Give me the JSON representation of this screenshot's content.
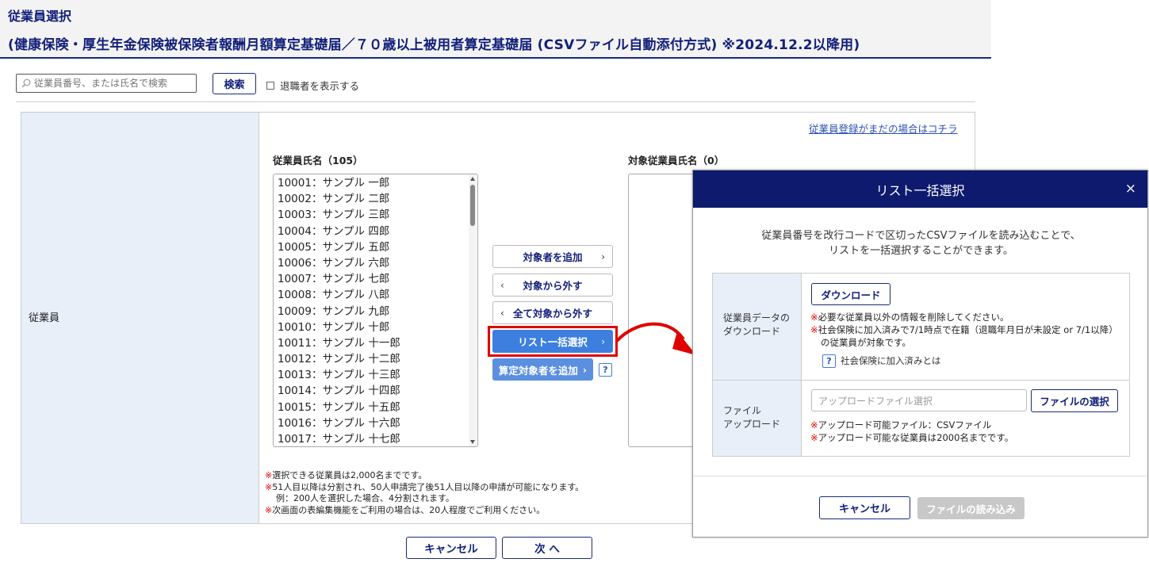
{
  "header": {
    "title": "従業員選択",
    "subtitle": "(健康保険・厚生年金保険被保険者報酬月額算定基礎届／７０歳以上被用者算定基礎届 (CSVファイル自動添付方式) ※2024.12.2以降用)"
  },
  "search": {
    "placeholder": "従業員番号、または氏名で検索",
    "button_label": "検索",
    "show_retired_label": "退職者を表示する"
  },
  "main": {
    "row_label": "従業員",
    "register_link": "従業員登録がまだの場合はコチラ",
    "employee_list_title": "従業員氏名（105）",
    "target_list_title": "対象従業員氏名（0）",
    "employees": [
      "10001：サンプル 一郎",
      "10002：サンプル 二郎",
      "10003：サンプル 三郎",
      "10004：サンプル 四郎",
      "10005：サンプル 五郎",
      "10006：サンプル 六郎",
      "10007：サンプル 七郎",
      "10008：サンプル 八郎",
      "10009：サンプル 九郎",
      "10010：サンプル 十郎",
      "10011：サンプル 十一郎",
      "10012：サンプル 十二郎",
      "10013：サンプル 十三郎",
      "10014：サンプル 十四郎",
      "10015：サンプル 十五郎",
      "10016：サンプル 十六郎",
      "10017：サンプル 十七郎"
    ],
    "buttons": {
      "add": "対象者を追加",
      "remove": "対象から外す",
      "remove_all": "全て対象から外す",
      "bulk_select": "リスト一括選択",
      "add_calc": "算定対象者を追加",
      "help": "?"
    },
    "notes": [
      "選択できる従業員は2,000名までです。",
      "51人目以降は分割され、50人申請完了後51人目以降の申請が可能になります。",
      "例：200人を選択した場合、4分割されます。",
      "次画面の表編集機能をご利用の場合は、20人程度でご利用ください。"
    ],
    "note_mark": "※"
  },
  "footer": {
    "cancel_label": "キャンセル",
    "next_label": "次 へ"
  },
  "modal": {
    "title": "リスト一括選択",
    "close": "×",
    "description_line1": "従業員番号を改行コードで区切ったCSVファイルを読み込むことで、",
    "description_line2": "リストを一括選択することができます。",
    "download_row_label_1": "従業員データの",
    "download_row_label_2": "ダウンロード",
    "download_button": "ダウンロード",
    "download_note_1": "必要な従業員以外の情報を削除してください。",
    "download_note_2": "社会保険に加入済みで7/1時点で在籍（退職年月日が未設定 or 7/1以降）",
    "download_note_3": "の従業員が対象です。",
    "help_link": "社会保険に加入済みとは",
    "upload_row_label_1": "ファイル",
    "upload_row_label_2": "アップロード",
    "upload_placeholder": "アップロードファイル選択",
    "file_select_button": "ファイルの選択",
    "upload_note_1": "アップロード可能ファイル：CSVファイル",
    "upload_note_2": "アップロード可能な従業員は2000名までです。",
    "cancel_button": "キャンセル",
    "load_button": "ファイルの読み込み"
  },
  "colors": {
    "navy": "#13207a",
    "modal_header": "#0d1a6e",
    "accent_blue": "#3d7fde",
    "highlight_red": "#e00000",
    "label_bg": "#e8eff8"
  }
}
